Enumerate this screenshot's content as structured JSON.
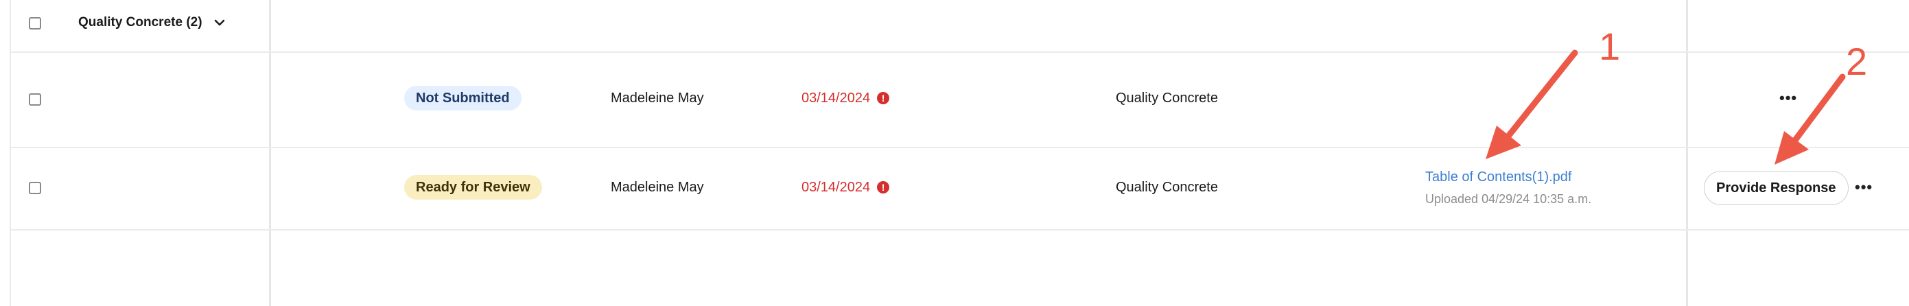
{
  "group": {
    "title": "Quality Concrete (2)"
  },
  "rows": [
    {
      "status": "Not Submitted",
      "assignee": "Madeleine May",
      "due_date": "03/14/2024",
      "company": "Quality Concrete"
    },
    {
      "status": "Ready for Review",
      "assignee": "Madeleine May",
      "due_date": "03/14/2024",
      "company": "Quality Concrete",
      "attachment": {
        "name": "Table of Contents(1).pdf",
        "uploaded": "Uploaded 04/29/24 10:35 a.m."
      },
      "action_label": "Provide Response"
    }
  ],
  "annotations": {
    "label_1": "1",
    "label_2": "2",
    "color": "#ec5a47"
  },
  "colors": {
    "status_blue_bg": "#e4efff",
    "status_yellow_bg": "#faeec0",
    "overdue_red": "#d62d2d",
    "link_blue": "#3b7fd0"
  }
}
